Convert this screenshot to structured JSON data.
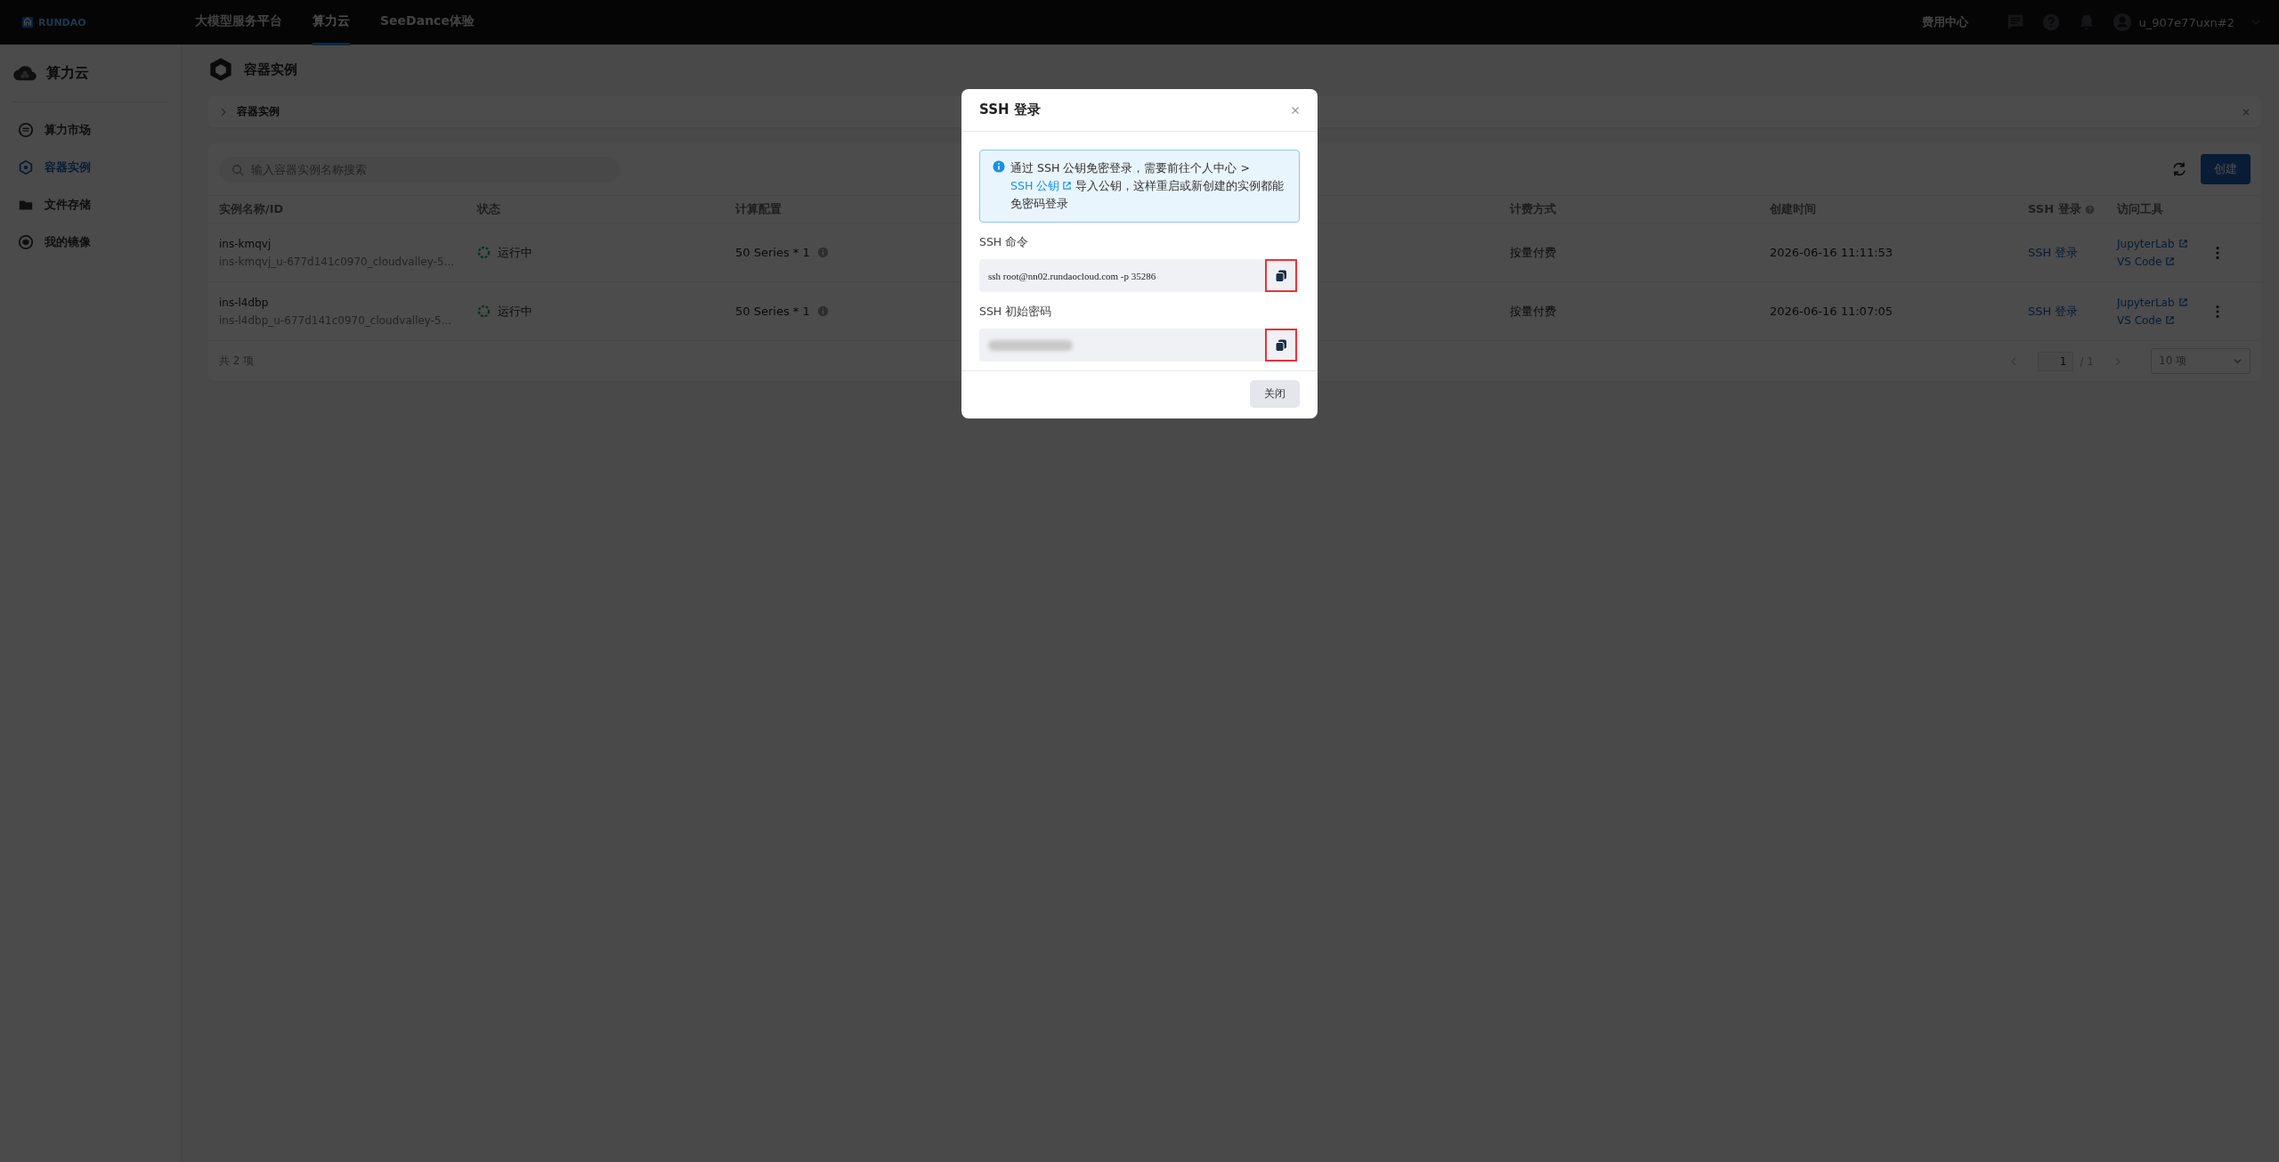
{
  "topbar": {
    "logo": "RUNDAO",
    "nav": [
      {
        "label": "大模型服务平台",
        "selected": false
      },
      {
        "label": "算力云",
        "selected": true
      },
      {
        "label": "SeeDance体验",
        "selected": false
      }
    ],
    "billing": "费用中心",
    "user": "u_907e77uxn#2"
  },
  "sidebar": {
    "title": "算力云",
    "items": [
      {
        "label": "算力市场",
        "selected": false
      },
      {
        "label": "容器实例",
        "selected": true
      },
      {
        "label": "文件存储",
        "selected": false
      },
      {
        "label": "我的镜像",
        "selected": false
      }
    ]
  },
  "page": {
    "title": "容器实例",
    "breadcrumb": "容器实例"
  },
  "toolbar": {
    "search": {
      "placeholder": "输入容器实例名称搜索"
    },
    "create": "创建"
  },
  "table": {
    "columns": [
      "实例名称/ID",
      "状态",
      "计算配置",
      "计费方式",
      "创建时间",
      "SSH 登录",
      "访问工具"
    ],
    "rows": [
      {
        "name": "ins-kmqvj",
        "id": "ins-kmqvj_u-677d141c0970_cloudvalley-5...",
        "status": "运行中",
        "config": "50 Series * 1",
        "billing": "按量付费",
        "created": "2026-06-16 11:11:53",
        "ssh": "SSH 登录",
        "tools": [
          "JupyterLab",
          "VS Code"
        ]
      },
      {
        "name": "ins-l4dbp",
        "id": "ins-l4dbp_u-677d141c0970_cloudvalley-5...",
        "status": "运行中",
        "config": "50 Series * 1",
        "billing": "按量付费",
        "created": "2026-06-16 11:07:05",
        "ssh": "SSH 登录",
        "tools": [
          "JupyterLab",
          "VS Code"
        ]
      }
    ],
    "total": "共 2 项",
    "page": "1",
    "pages": "/ 1",
    "page_size": "10 项"
  },
  "dialog": {
    "title": "SSH 登录",
    "notice_before": "通过 SSH 公钥免密登录，需要前往个人中心 >",
    "notice_link": "SSH 公钥",
    "notice_after": "导入公钥，这样重启或新创建的实例都能免密码登录",
    "fields": [
      {
        "label": "SSH 命令",
        "kind": "text",
        "value": "ssh root@nn02.rundaocloud.com -p 35286",
        "highlighted": true
      },
      {
        "label": "SSH 初始密码",
        "kind": "masked",
        "highlighted": true
      }
    ],
    "close": "关闭"
  }
}
